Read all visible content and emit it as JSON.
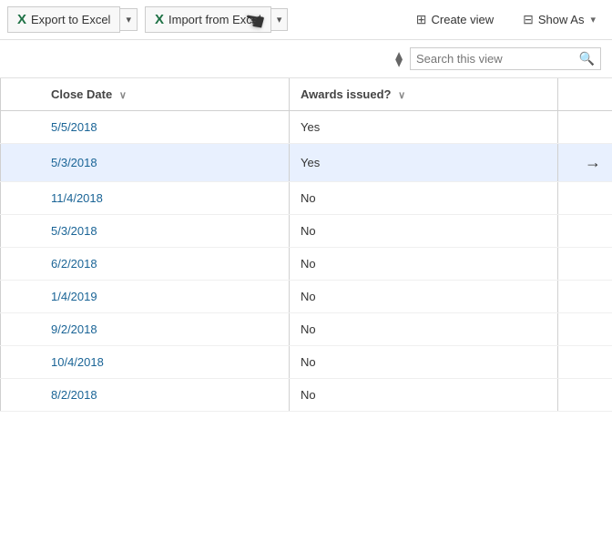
{
  "toolbar": {
    "export_label": "Export to Excel",
    "import_label": "Import from Excel",
    "create_view_label": "Create view",
    "show_as_label": "Show As",
    "dropdown_arrow": "▾"
  },
  "search": {
    "placeholder": "Search this view",
    "filter_icon": "⧫"
  },
  "table": {
    "columns": [
      {
        "label": "Close Date",
        "sortable": true
      },
      {
        "label": "Awards issued?",
        "sortable": true
      }
    ],
    "rows": [
      {
        "close_date": "5/5/2018",
        "awards_issued": "Yes",
        "highlighted": false,
        "arrow": false
      },
      {
        "close_date": "5/3/2018",
        "awards_issued": "Yes",
        "highlighted": true,
        "arrow": true
      },
      {
        "close_date": "11/4/2018",
        "awards_issued": "No",
        "highlighted": false,
        "arrow": false
      },
      {
        "close_date": "5/3/2018",
        "awards_issued": "No",
        "highlighted": false,
        "arrow": false
      },
      {
        "close_date": "6/2/2018",
        "awards_issued": "No",
        "highlighted": false,
        "arrow": false
      },
      {
        "close_date": "1/4/2019",
        "awards_issued": "No",
        "highlighted": false,
        "arrow": false
      },
      {
        "close_date": "9/2/2018",
        "awards_issued": "No",
        "highlighted": false,
        "arrow": false
      },
      {
        "close_date": "10/4/2018",
        "awards_issued": "No",
        "highlighted": false,
        "arrow": false
      },
      {
        "close_date": "8/2/2018",
        "awards_issued": "No",
        "highlighted": false,
        "arrow": false
      }
    ]
  }
}
